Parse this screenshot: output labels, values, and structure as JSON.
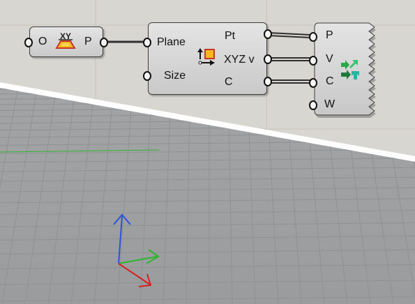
{
  "canvas": {
    "background": "#d8d6d0",
    "grid_color": "#c3c1ba",
    "viewport_color": "#9ea0a1"
  },
  "xy_plane_component": {
    "icon": "xy-plane-icon",
    "icon_text": "XY",
    "input_label": "O",
    "output_label": "P"
  },
  "box_component": {
    "icon": "deconstruct-box-icon",
    "inputs": [
      "Plane",
      "Size"
    ],
    "outputs": [
      "Pt",
      "XYZ v",
      "C"
    ]
  },
  "vector_component": {
    "icon": "vector-display-icon",
    "inputs": [
      "P",
      "V",
      "C",
      "W"
    ]
  },
  "viewport": {
    "axes": {
      "x_color": "#d42020",
      "y_color": "#2fb52f",
      "z_color": "#2a55d8"
    }
  }
}
